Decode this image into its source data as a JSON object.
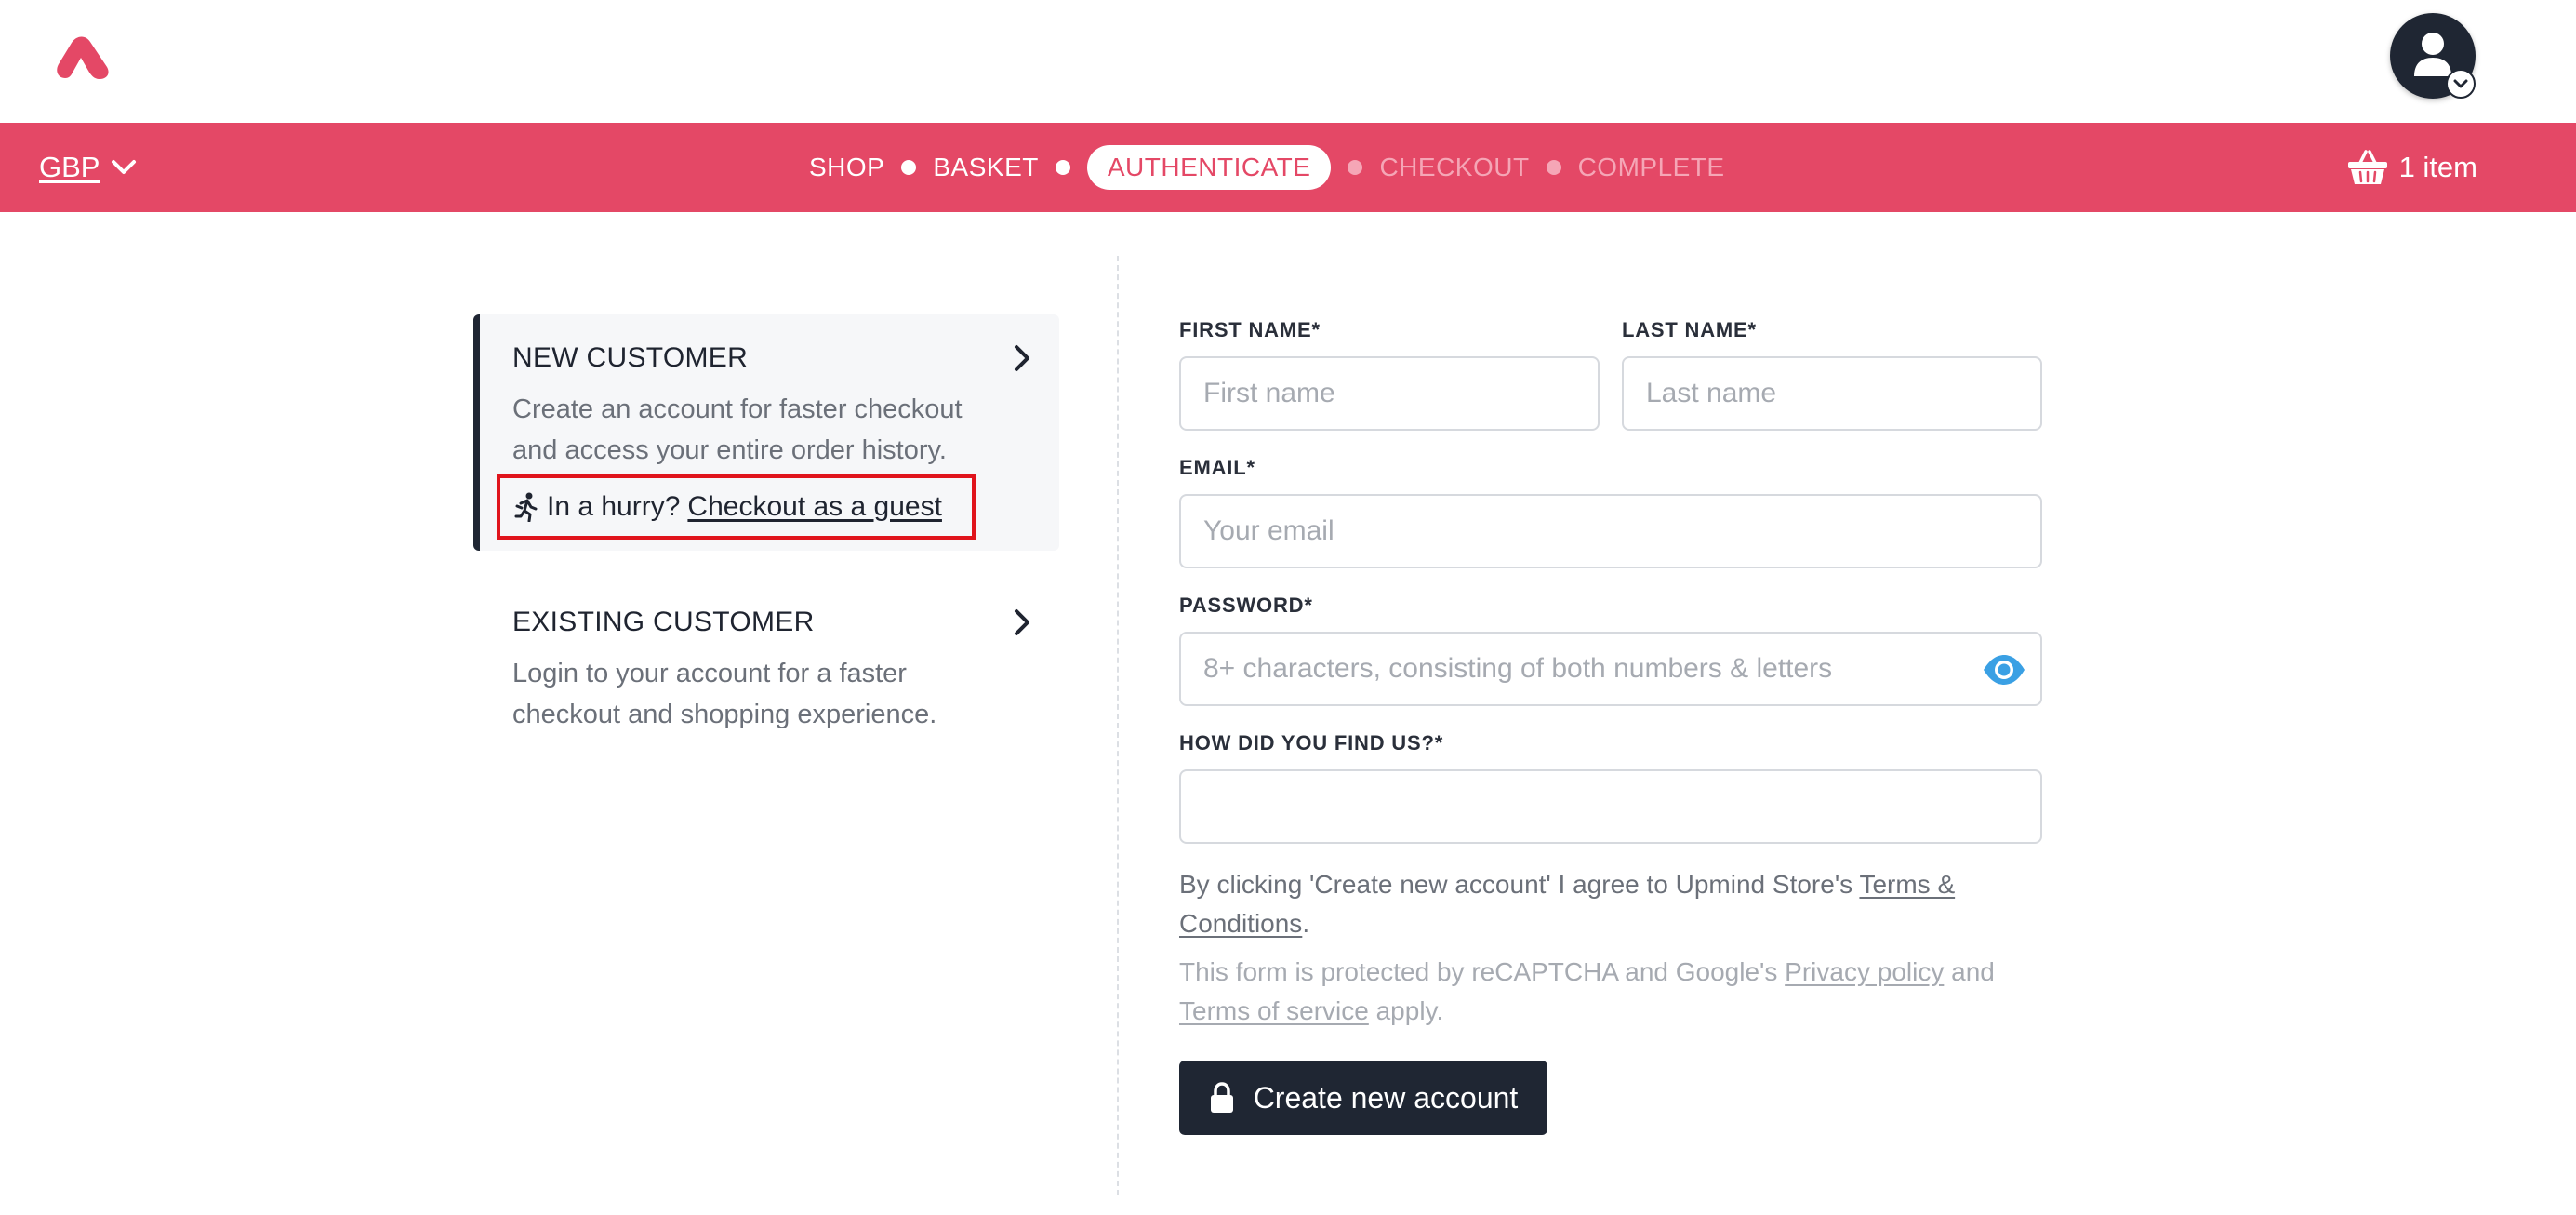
{
  "header": {
    "logo_icon": "brand-logo-icon",
    "account_icon": "user-avatar-icon",
    "brand_color": "#e44866",
    "dark_color": "#1f2633"
  },
  "navbar": {
    "currency": "GBP",
    "steps": [
      {
        "label": "SHOP",
        "state": "done"
      },
      {
        "label": "BASKET",
        "state": "done"
      },
      {
        "label": "AUTHENTICATE",
        "state": "active"
      },
      {
        "label": "CHECKOUT",
        "state": "pending"
      },
      {
        "label": "COMPLETE",
        "state": "pending"
      }
    ],
    "cart_label": "1 item"
  },
  "auth": {
    "new_customer": {
      "title": "NEW CUSTOMER",
      "description": "Create an account for faster checkout and access your entire order history.",
      "hurry_text": "In a hurry?",
      "guest_link": "Checkout as a guest"
    },
    "existing_customer": {
      "title": "EXISTING CUSTOMER",
      "description": "Login to your account for a faster checkout and shopping experience."
    }
  },
  "form": {
    "first_name": {
      "label": "FIRST NAME*",
      "placeholder": "First name",
      "value": ""
    },
    "last_name": {
      "label": "LAST NAME*",
      "placeholder": "Last name",
      "value": ""
    },
    "email": {
      "label": "EMAIL*",
      "placeholder": "Your email",
      "value": ""
    },
    "password": {
      "label": "PASSWORD*",
      "placeholder": "8+ characters, consisting of both numbers & letters",
      "value": ""
    },
    "find_us": {
      "label": "HOW DID YOU FIND US?*",
      "value": ""
    },
    "terms": {
      "prefix": "By clicking 'Create new account' I agree to Upmind Store's ",
      "link": "Terms & Conditions",
      "suffix": "."
    },
    "recaptcha": {
      "prefix": "This form is protected by reCAPTCHA and Google's ",
      "privacy_link": "Privacy policy",
      "middle": " and ",
      "terms_link": "Terms of service",
      "suffix": " apply."
    },
    "submit_label": "Create new account"
  }
}
